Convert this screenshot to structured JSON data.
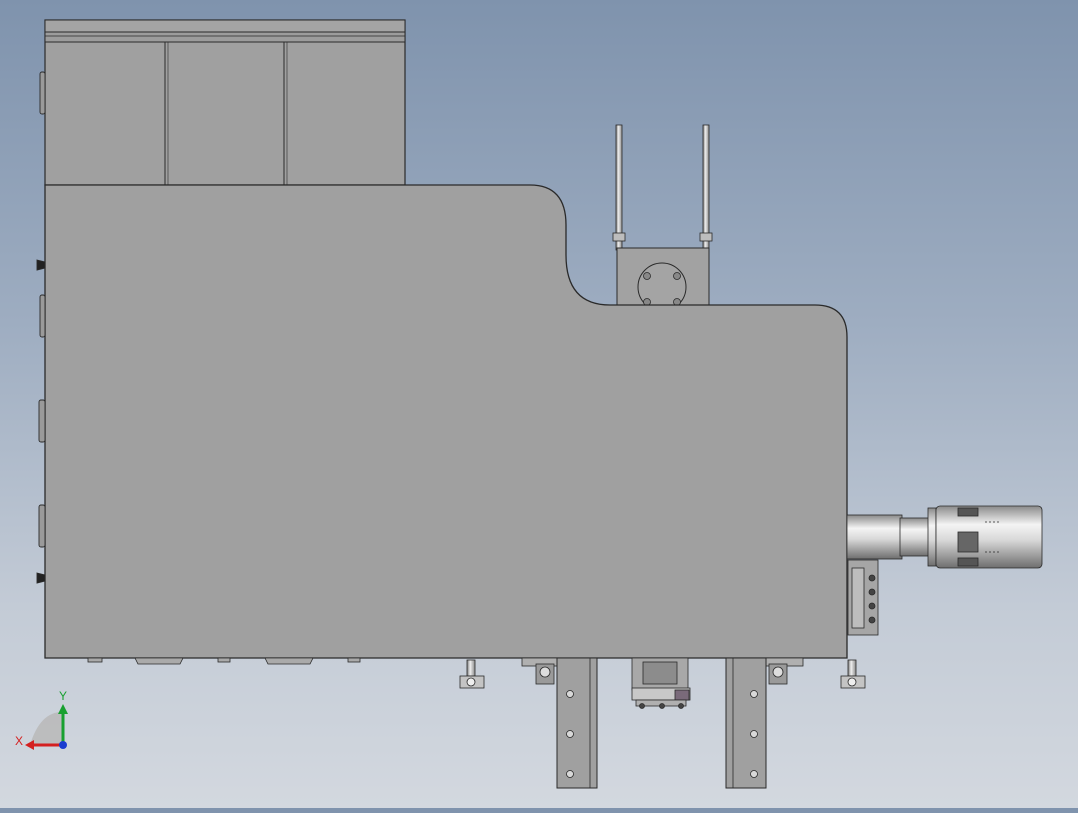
{
  "viewport": {
    "background_top": "#7f93ad",
    "background_bottom": "#d3d8df",
    "body_fill": "#a0a0a0",
    "edge_color": "#2a2a2a"
  },
  "model": {
    "upper_panels": 3,
    "rods": 2,
    "support_legs": 2,
    "leg_holes_per_leg": 3
  },
  "triad": {
    "x_label": "X",
    "y_label": "Y",
    "x_color": "#d42020",
    "y_color": "#18a030",
    "z_color": "#1a3cd0"
  }
}
